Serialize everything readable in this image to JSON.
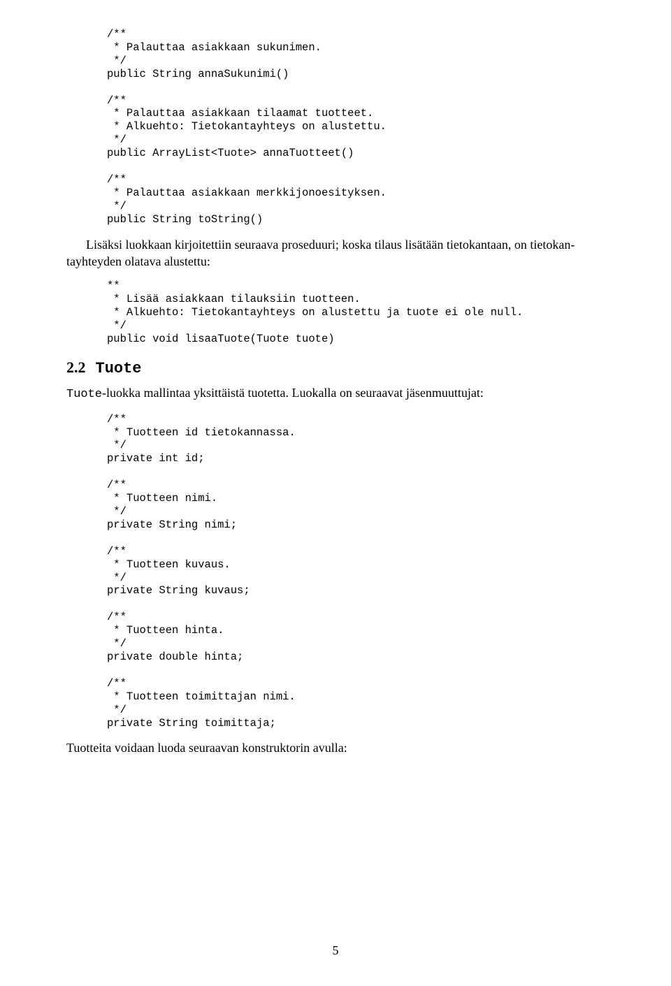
{
  "code1": "/**\n * Palauttaa asiakkaan sukunimen.\n */\npublic String annaSukunimi()\n\n/**\n * Palauttaa asiakkaan tilaamat tuotteet.\n * Alkuehto: Tietokantayhteys on alustettu.\n */\npublic ArrayList<Tuote> annaTuotteet()\n\n/**\n * Palauttaa asiakkaan merkkijonoesityksen.\n */\npublic String toString()",
  "para1a": "Lisäksi luokkaan kirjoitettiin seuraava proseduuri; koska tilaus lisätään tietokantaan, on tietokan-",
  "para1b": "tayhteyden olatava alustettu:",
  "code2": "**\n * Lisää asiakkaan tilauksiin tuotteen.\n * Alkuehto: Tietokantayhteys on alustettu ja tuote ei ole null.\n */\npublic void lisaaTuote(Tuote tuote)",
  "sectionNumber": "2.2",
  "sectionTitle": "Tuote",
  "para2a": "Tuote",
  "para2b": "-luokka mallintaa yksittäistä tuotetta. Luokalla on seuraavat jäsenmuuttujat:",
  "code3": "/**\n * Tuotteen id tietokannassa.\n */\nprivate int id;\n\n/**\n * Tuotteen nimi.\n */\nprivate String nimi;\n\n/**\n * Tuotteen kuvaus.\n */\nprivate String kuvaus;\n\n/**\n * Tuotteen hinta.\n */\nprivate double hinta;\n\n/**\n * Tuotteen toimittajan nimi.\n */\nprivate String toimittaja;",
  "para3": "Tuotteita voidaan luoda seuraavan konstruktorin avulla:",
  "pageNumber": "5"
}
